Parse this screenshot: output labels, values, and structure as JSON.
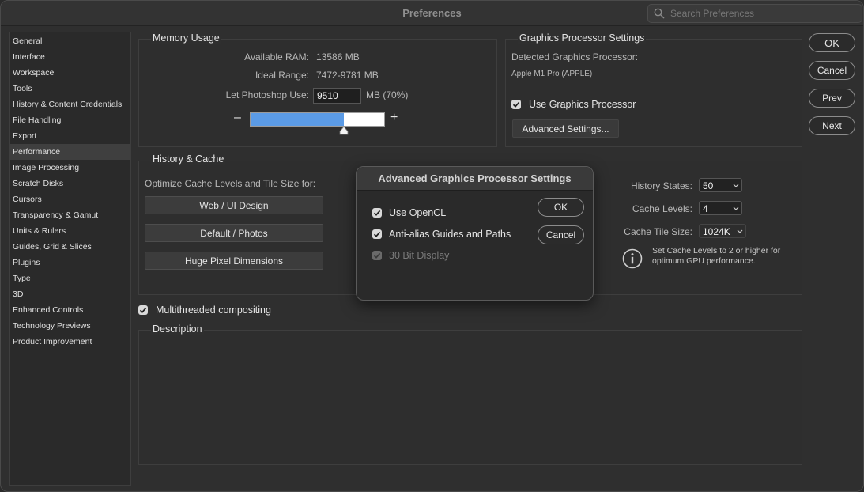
{
  "window": {
    "title": "Preferences"
  },
  "search": {
    "placeholder": "Search Preferences"
  },
  "sidebar": {
    "items": [
      {
        "label": "General"
      },
      {
        "label": "Interface"
      },
      {
        "label": "Workspace"
      },
      {
        "label": "Tools"
      },
      {
        "label": "History & Content Credentials"
      },
      {
        "label": "File Handling"
      },
      {
        "label": "Export"
      },
      {
        "label": "Performance"
      },
      {
        "label": "Image Processing"
      },
      {
        "label": "Scratch Disks"
      },
      {
        "label": "Cursors"
      },
      {
        "label": "Transparency & Gamut"
      },
      {
        "label": "Units & Rulers"
      },
      {
        "label": "Guides, Grid & Slices"
      },
      {
        "label": "Plugins"
      },
      {
        "label": "Type"
      },
      {
        "label": "3D"
      },
      {
        "label": "Enhanced Controls"
      },
      {
        "label": "Technology Previews"
      },
      {
        "label": "Product Improvement"
      }
    ],
    "active": "Performance"
  },
  "memory": {
    "title": "Memory Usage",
    "available_label": "Available RAM:",
    "available_value": "13586 MB",
    "ideal_label": "Ideal Range:",
    "ideal_value": "7472-9781 MB",
    "use_label": "Let Photoshop Use:",
    "use_value": "9510",
    "use_unit": "MB (70%)",
    "minus": "–",
    "plus": "+",
    "slider_fraction": 0.7
  },
  "gpu": {
    "title": "Graphics Processor Settings",
    "detected_label": "Detected Graphics Processor:",
    "detected_value": "Apple M1 Pro (APPLE)",
    "use_gpu_label": "Use Graphics Processor",
    "advanced_button": "Advanced Settings..."
  },
  "history_cache": {
    "title": "History & Cache",
    "optimize_label": "Optimize Cache Levels and Tile Size for:",
    "buttons": [
      "Web / UI Design",
      "Default / Photos",
      "Huge Pixel Dimensions"
    ],
    "history_states_label": "History States:",
    "history_states_value": "50",
    "cache_levels_label": "Cache Levels:",
    "cache_levels_value": "4",
    "tile_size_label": "Cache Tile Size:",
    "tile_size_value": "1024K",
    "info_text_1": "Set Cache Levels to 2 or higher for",
    "info_text_2": "optimum GPU performance."
  },
  "multithreaded": {
    "label": "Multithreaded compositing"
  },
  "description": {
    "title": "Description"
  },
  "actions": {
    "ok": "OK",
    "cancel": "Cancel",
    "prev": "Prev",
    "next": "Next"
  },
  "dialog": {
    "title": "Advanced Graphics Processor Settings",
    "opencl_label": "Use OpenCL",
    "antialias_label": "Anti-alias Guides and Paths",
    "bit30_label": "30 Bit Display",
    "ok": "OK",
    "cancel": "Cancel"
  },
  "colors": {
    "slider_fill": "#5b9be6",
    "accent": "#d9d9d9"
  }
}
